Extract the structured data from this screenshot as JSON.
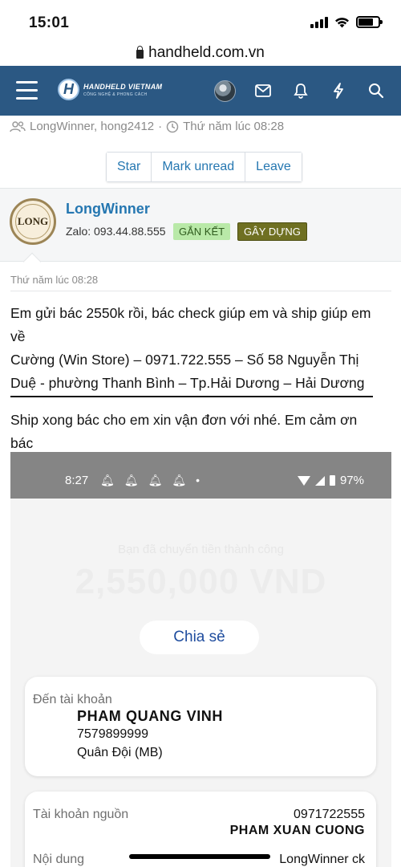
{
  "status_bar": {
    "time": "15:01"
  },
  "browser": {
    "url": "handheld.com.vn"
  },
  "site": {
    "logo_main": "HANDHELD VIETNAM",
    "logo_sub": "CÔNG NGHỆ & PHONG CÁCH",
    "nav_icons": [
      "avatar",
      "mail-icon",
      "bell-icon",
      "bolt-icon",
      "search-icon"
    ]
  },
  "thread": {
    "participants": "LongWinner, hong2412",
    "separator": "·",
    "time": "Thứ năm lúc 08:28",
    "actions": [
      "Star",
      "Mark unread",
      "Leave"
    ]
  },
  "message": {
    "avatar_text": "LONG",
    "username": "LongWinner",
    "zalo": "Zalo: 093.44.88.555",
    "badges": [
      "GẮN KẾT",
      "GÂY DỰNG"
    ],
    "date": "Thứ năm lúc 08:28",
    "body_lines": [
      "Em gửi bác 2550k rồi, bác check giúp em và ship giúp em",
      "về",
      "Cường (Win Store) – 0971.722.555 – Số 58 Nguyễn Thị",
      "Duệ - phường Thanh Bình – Tp.Hải Dương – Hải Dương"
    ],
    "body2_lines": [
      "Ship xong bác cho em xin vận đơn với nhé. Em cảm ơn",
      "bác"
    ]
  },
  "embedded": {
    "time": "8:27",
    "battery": "97%",
    "faint_text": "Bạn đã chuyển tiền thành công",
    "amount": "2,550,000 VND",
    "share": "Chia sẻ",
    "to_label": "Đến tài khoản",
    "to_name": "PHAM QUANG VINH",
    "to_account": "7579899999",
    "to_bank": "Quân Đội (MB)",
    "from_label": "Tài khoản nguồn",
    "from_account": "0971722555",
    "from_name": "PHAM XUAN CUONG",
    "content_label": "Nội dung",
    "content_value": "LongWinner ck"
  }
}
